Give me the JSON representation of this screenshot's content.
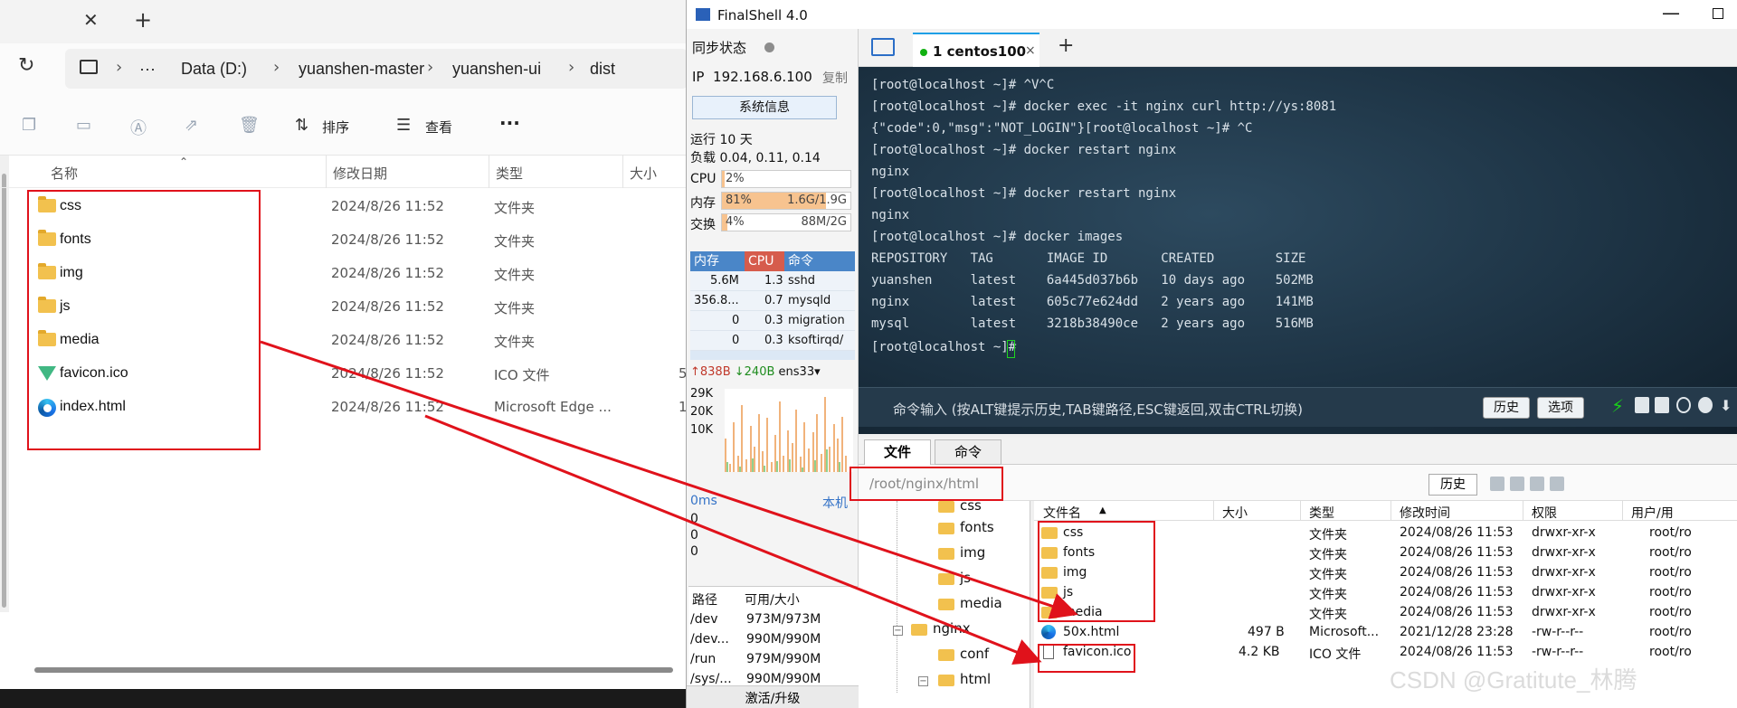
{
  "explorer": {
    "breadcrumb": [
      "···",
      "Data (D:)",
      "yuanshen-master",
      "yuanshen-ui",
      "dist"
    ],
    "toolbar": {
      "sort_label": "排序",
      "view_label": "查看",
      "more_label": "···"
    },
    "columns": {
      "name": "名称",
      "date": "修改日期",
      "type": "类型",
      "size": "大小"
    },
    "files": [
      {
        "name": "css",
        "date": "2024/8/26 11:52",
        "type": "文件夹",
        "icon": "folder-icon"
      },
      {
        "name": "fonts",
        "date": "2024/8/26 11:52",
        "type": "文件夹",
        "icon": "folder-icon"
      },
      {
        "name": "img",
        "date": "2024/8/26 11:52",
        "type": "文件夹",
        "icon": "folder-icon"
      },
      {
        "name": "js",
        "date": "2024/8/26 11:52",
        "type": "文件夹",
        "icon": "folder-icon"
      },
      {
        "name": "media",
        "date": "2024/8/26 11:52",
        "type": "文件夹",
        "icon": "folder-icon"
      },
      {
        "name": "favicon.ico",
        "date": "2024/8/26 11:52",
        "type": "ICO 文件",
        "size": "5",
        "icon": "vue-icon"
      },
      {
        "name": "index.html",
        "date": "2024/8/26 11:52",
        "type": "Microsoft Edge ...",
        "size": "1",
        "icon": "edge-icon"
      }
    ]
  },
  "finalshell": {
    "title": "FinalShell 4.0",
    "left": {
      "sync_label": "同步状态",
      "ip_label": "IP",
      "ip": "192.168.6.100",
      "copy_label": "复制",
      "sysinfo_button": "系统信息",
      "uptime": "运行 10 天",
      "load": "负载 0.04, 0.11, 0.14",
      "cpu": {
        "label": "CPU",
        "value": "2%",
        "fraction": 0.02
      },
      "mem": {
        "label": "内存",
        "value": "81%",
        "detail": "1.6G/1.9G",
        "fraction": 0.81
      },
      "swap": {
        "label": "交换",
        "value": "4%",
        "detail": "88M/2G",
        "fraction": 0.04
      },
      "proc_headers": {
        "mem": "内存",
        "cpu": "CPU",
        "cmd": "命令"
      },
      "processes": [
        {
          "mem": "5.6M",
          "cpu": "1.3",
          "cmd": "sshd"
        },
        {
          "mem": "356.8...",
          "cpu": "0.7",
          "cmd": "mysqld"
        },
        {
          "mem": "0",
          "cpu": "0.3",
          "cmd": "migration"
        },
        {
          "mem": "0",
          "cpu": "0.3",
          "cmd": "ksoftirqd/"
        }
      ],
      "net": {
        "up": "↑838B",
        "down": "↓240B",
        "iface": "ens33"
      },
      "graph_ticks": [
        "29K",
        "20K",
        "10K"
      ],
      "latency": {
        "ms": "0ms",
        "host": "本机",
        "values": [
          "0",
          "0",
          "0"
        ]
      },
      "disk_headers": {
        "path": "路径",
        "usage": "可用/大小"
      },
      "disks": [
        {
          "path": "/dev",
          "usage": "973M/973M"
        },
        {
          "path": "/dev...",
          "usage": "990M/990M"
        },
        {
          "path": "/run",
          "usage": "979M/990M"
        },
        {
          "path": "/sys/...",
          "usage": "990M/990M"
        }
      ],
      "activate_label": "激活/升级"
    },
    "tab": {
      "label": "1 centos100",
      "close": "×",
      "add": "+"
    },
    "terminal": {
      "lines": [
        "[root@localhost ~]# ^V^C",
        "[root@localhost ~]# docker exec -it nginx curl http://ys:8081",
        "{\"code\":0,\"msg\":\"NOT_LOGIN\"}[root@localhost ~]# ^C",
        "[root@localhost ~]# docker restart nginx",
        "nginx",
        "[root@localhost ~]# docker restart nginx",
        "nginx",
        "[root@localhost ~]# docker images",
        "REPOSITORY   TAG       IMAGE ID       CREATED        SIZE",
        "yuanshen     latest    6a445d037b6b   10 days ago    502MB",
        "nginx        latest    605c77e624dd   2 years ago    141MB",
        "mysql        latest    3218b38490ce   2 years ago    516MB",
        "[root@localhost ~]# "
      ],
      "cmd_hint": "命令输入 (按ALT键提示历史,TAB键路径,ESC键返回,双击CTRL切换)",
      "history_button": "历史",
      "options_button": "选项"
    },
    "file_tabs": {
      "files": "文件",
      "commands": "命令"
    },
    "path": "/root/nginx/html",
    "path_history": "历史",
    "tree": [
      {
        "name": "css",
        "level": 2
      },
      {
        "name": "fonts",
        "level": 2
      },
      {
        "name": "img",
        "level": 2
      },
      {
        "name": "js",
        "level": 2
      },
      {
        "name": "media",
        "level": 2
      },
      {
        "name": "nginx",
        "level": 1,
        "expander": "−"
      },
      {
        "name": "conf",
        "level": 2
      },
      {
        "name": "html",
        "level": 2,
        "expander": "−"
      }
    ],
    "file_columns": {
      "name": "文件名",
      "size": "大小",
      "type": "类型",
      "mtime": "修改时间",
      "perm": "权限",
      "owner": "用户/用"
    },
    "remote_files": [
      {
        "name": "css",
        "size": "",
        "type": "文件夹",
        "mtime": "2024/08/26 11:53",
        "perm": "drwxr-xr-x",
        "owner": "root/ro",
        "icon": "folder-icon"
      },
      {
        "name": "fonts",
        "size": "",
        "type": "文件夹",
        "mtime": "2024/08/26 11:53",
        "perm": "drwxr-xr-x",
        "owner": "root/ro",
        "icon": "folder-icon"
      },
      {
        "name": "img",
        "size": "",
        "type": "文件夹",
        "mtime": "2024/08/26 11:53",
        "perm": "drwxr-xr-x",
        "owner": "root/ro",
        "icon": "folder-icon"
      },
      {
        "name": "js",
        "size": "",
        "type": "文件夹",
        "mtime": "2024/08/26 11:53",
        "perm": "drwxr-xr-x",
        "owner": "root/ro",
        "icon": "folder-icon"
      },
      {
        "name": "media",
        "size": "",
        "type": "文件夹",
        "mtime": "2024/08/26 11:53",
        "perm": "drwxr-xr-x",
        "owner": "root/ro",
        "icon": "folder-icon"
      },
      {
        "name": "50x.html",
        "size": "497 B",
        "type": "Microsoft...",
        "mtime": "2021/12/28 23:28",
        "perm": "-rw-r--r--",
        "owner": "root/ro",
        "icon": "edge-icon"
      },
      {
        "name": "favicon.ico",
        "size": "4.2 KB",
        "type": "ICO 文件",
        "mtime": "2024/08/26 11:53",
        "perm": "-rw-r--r--",
        "owner": "root/ro",
        "icon": "file-icon"
      }
    ]
  },
  "watermark": "CSDN @Gratitute_林腾",
  "colors": {
    "annotation_red": "#e0121b",
    "terminal_bg": "#1d3344",
    "accent_blue": "#2b6ec7",
    "online_green": "#12b112"
  }
}
